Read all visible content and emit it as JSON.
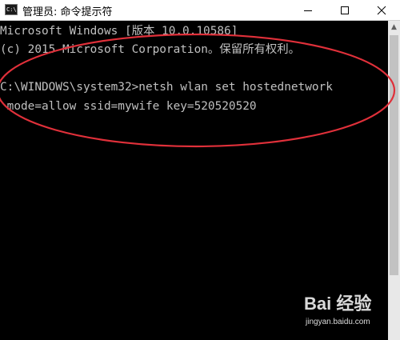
{
  "window": {
    "title": "管理员: 命令提示符",
    "icon": "cmd-icon",
    "controls": [
      "minimize-icon",
      "maximize-icon",
      "close-icon"
    ]
  },
  "console": {
    "lines": [
      "Microsoft Windows [版本 10.0.10586]",
      "(c) 2015 Microsoft Corporation。保留所有权利。",
      "C:\\WINDOWS\\system32>netsh wlan set hostednetwork",
      " mode=allow ssid=mywife key=520520520"
    ]
  },
  "annotation": {
    "color": "#e0303a"
  },
  "watermark": {
    "brand": "Bai 经验",
    "url": "jingyan.baidu.com"
  },
  "colors": {
    "console_bg": "#000000",
    "console_text": "#c0c0c0",
    "titlebar_bg": "#ffffff"
  }
}
